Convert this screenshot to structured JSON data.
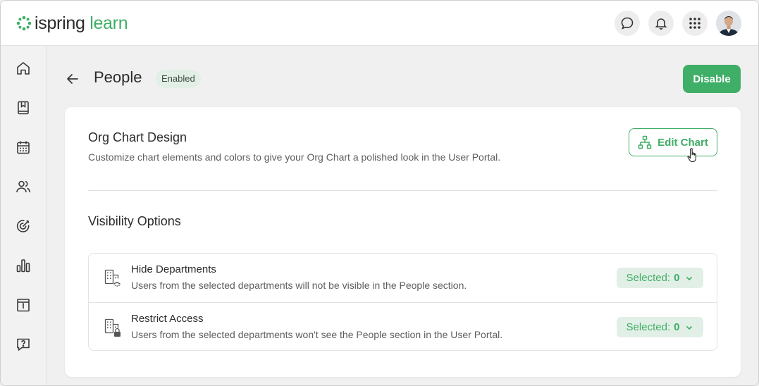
{
  "brand": {
    "name_part1": "ispring",
    "name_part2": "learn",
    "accent": "#3fae66"
  },
  "topbar": {
    "icons": [
      "chat-icon",
      "bell-icon",
      "apps-grid-icon",
      "user-avatar"
    ]
  },
  "sidebar": {
    "items": [
      "home-icon",
      "courses-icon",
      "calendar-icon",
      "people-icon",
      "goals-icon",
      "reports-icon",
      "info-icon",
      "help-icon"
    ]
  },
  "header": {
    "title": "People",
    "status": "Enabled",
    "disable_label": "Disable"
  },
  "org_chart": {
    "title": "Org Chart Design",
    "description": "Customize chart elements and colors to give your Org Chart a polished look in the User Portal.",
    "edit_label": "Edit Chart"
  },
  "visibility": {
    "title": "Visibility Options",
    "options": [
      {
        "title": "Hide Departments",
        "description": "Users from the selected departments will not be visible in the People section.",
        "selected_label": "Selected:",
        "selected_count": "0"
      },
      {
        "title": "Restrict Access",
        "description": "Users from the selected departments won't see the People section in the User Portal.",
        "selected_label": "Selected:",
        "selected_count": "0"
      }
    ]
  }
}
